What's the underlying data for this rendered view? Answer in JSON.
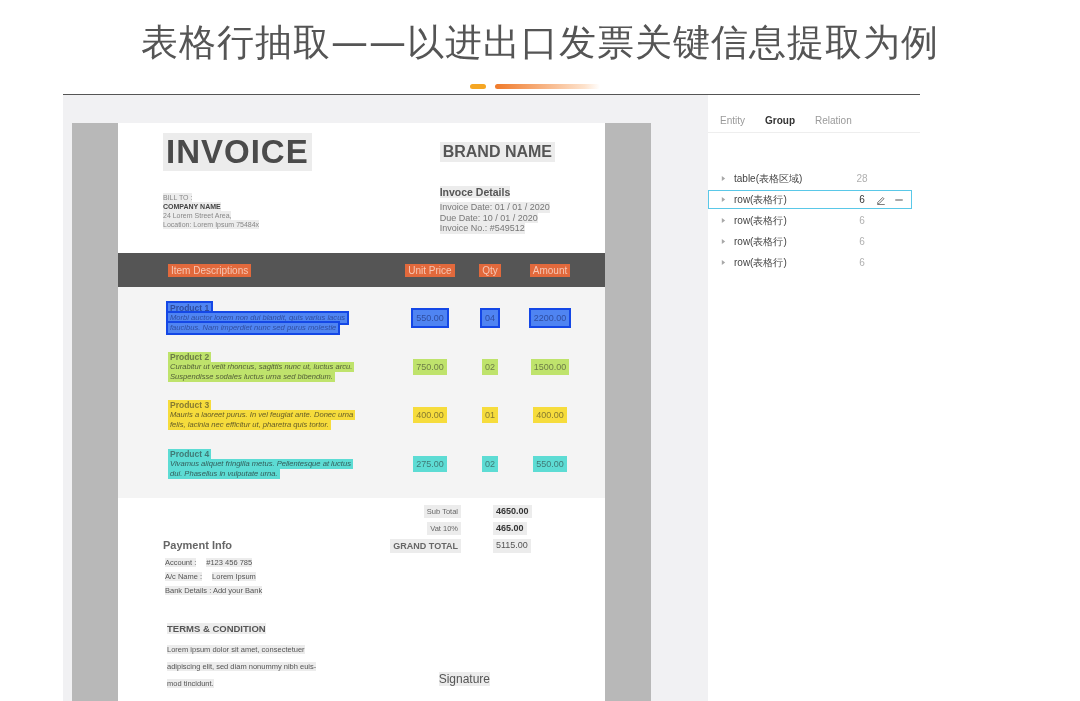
{
  "title": "表格行抽取——以进出口发票关键信息提取为例",
  "document": {
    "invoice_title": "INVOICE",
    "brand": "BRAND NAME",
    "bill_to": [
      "BILL TO :",
      "COMPANY NAME",
      "24 Lorem Street Area,",
      "Location: Lorem Ipsum 75484x"
    ],
    "details_heading": "Invoce Details",
    "details": [
      "Invoice Date: 01 / 01 / 2020",
      "Due Date: 10 / 01 / 2020",
      "Invoice No.: #549512"
    ],
    "columns": [
      "Item Descriptions",
      "Unit Price",
      "Qty",
      "Amount"
    ],
    "rows": [
      {
        "product": "Product 1",
        "description": [
          "Morbi auctor lorem non dui blandit, quis varius lacus",
          "faucibus. Nam imperdiet nunc sed purus molestie"
        ],
        "unit_price": "550.00",
        "qty": "04",
        "amount": "2200.00",
        "color": "#4f84f2",
        "selected": true
      },
      {
        "product": "Product 2",
        "description": [
          "Curabitur ut velit rhoncus, sagittis nunc ut, luctus arcu.",
          "Suspendisse sodales luctus urna sed bibendum."
        ],
        "unit_price": "750.00",
        "qty": "02",
        "amount": "1500.00",
        "color": "#bfe36c",
        "selected": false
      },
      {
        "product": "Product 3",
        "description": [
          "Mauris a laoreet purus. In vel feugiat ante. Donec urna",
          "felis, lacinia nec efficitur ut, pharetra quis tortor."
        ],
        "unit_price": "400.00",
        "qty": "01",
        "amount": "400.00",
        "color": "#f6dc3c",
        "selected": false
      },
      {
        "product": "Product 4",
        "description": [
          "Vivamus aliquet fringilla metus. Pellentesque at luctus",
          "dui. Phasellus in vulputate urna."
        ],
        "unit_price": "275.00",
        "qty": "02",
        "amount": "550.00",
        "color": "#5ddcd4",
        "selected": false
      }
    ],
    "totals": [
      {
        "label": "Sub Total",
        "value": "4650.00"
      },
      {
        "label": "Vat 10%",
        "value": "465.00"
      },
      {
        "label": "GRAND TOTAL",
        "value": "5115.00"
      }
    ],
    "payment": {
      "heading": "Payment Info",
      "lines": [
        {
          "label": "Account :",
          "value": "#123 456 785"
        },
        {
          "label": "A/c Name :",
          "value": "Lorem Ipsum"
        },
        {
          "label": "Bank Details : Add your Bank"
        }
      ]
    },
    "terms": {
      "heading": "TERMS & CONDITION",
      "lines": [
        "Lorem ipsum dolor sit amet, consectetuer",
        "adipiscing elit, sed diam nonummy nibh euis-",
        "mod tincidunt."
      ]
    },
    "signature": "Signature"
  },
  "panel": {
    "tabs": [
      {
        "label": "Entity",
        "selected": false
      },
      {
        "label": "Group",
        "selected": true
      },
      {
        "label": "Relation",
        "selected": false
      }
    ],
    "groups": [
      {
        "label": "table(表格区域)",
        "count": "28",
        "selected": false
      },
      {
        "label": "row(表格行)",
        "count": "6",
        "selected": true
      },
      {
        "label": "row(表格行)",
        "count": "6",
        "selected": false
      },
      {
        "label": "row(表格行)",
        "count": "6",
        "selected": false
      },
      {
        "label": "row(表格行)",
        "count": "6",
        "selected": false
      }
    ]
  }
}
